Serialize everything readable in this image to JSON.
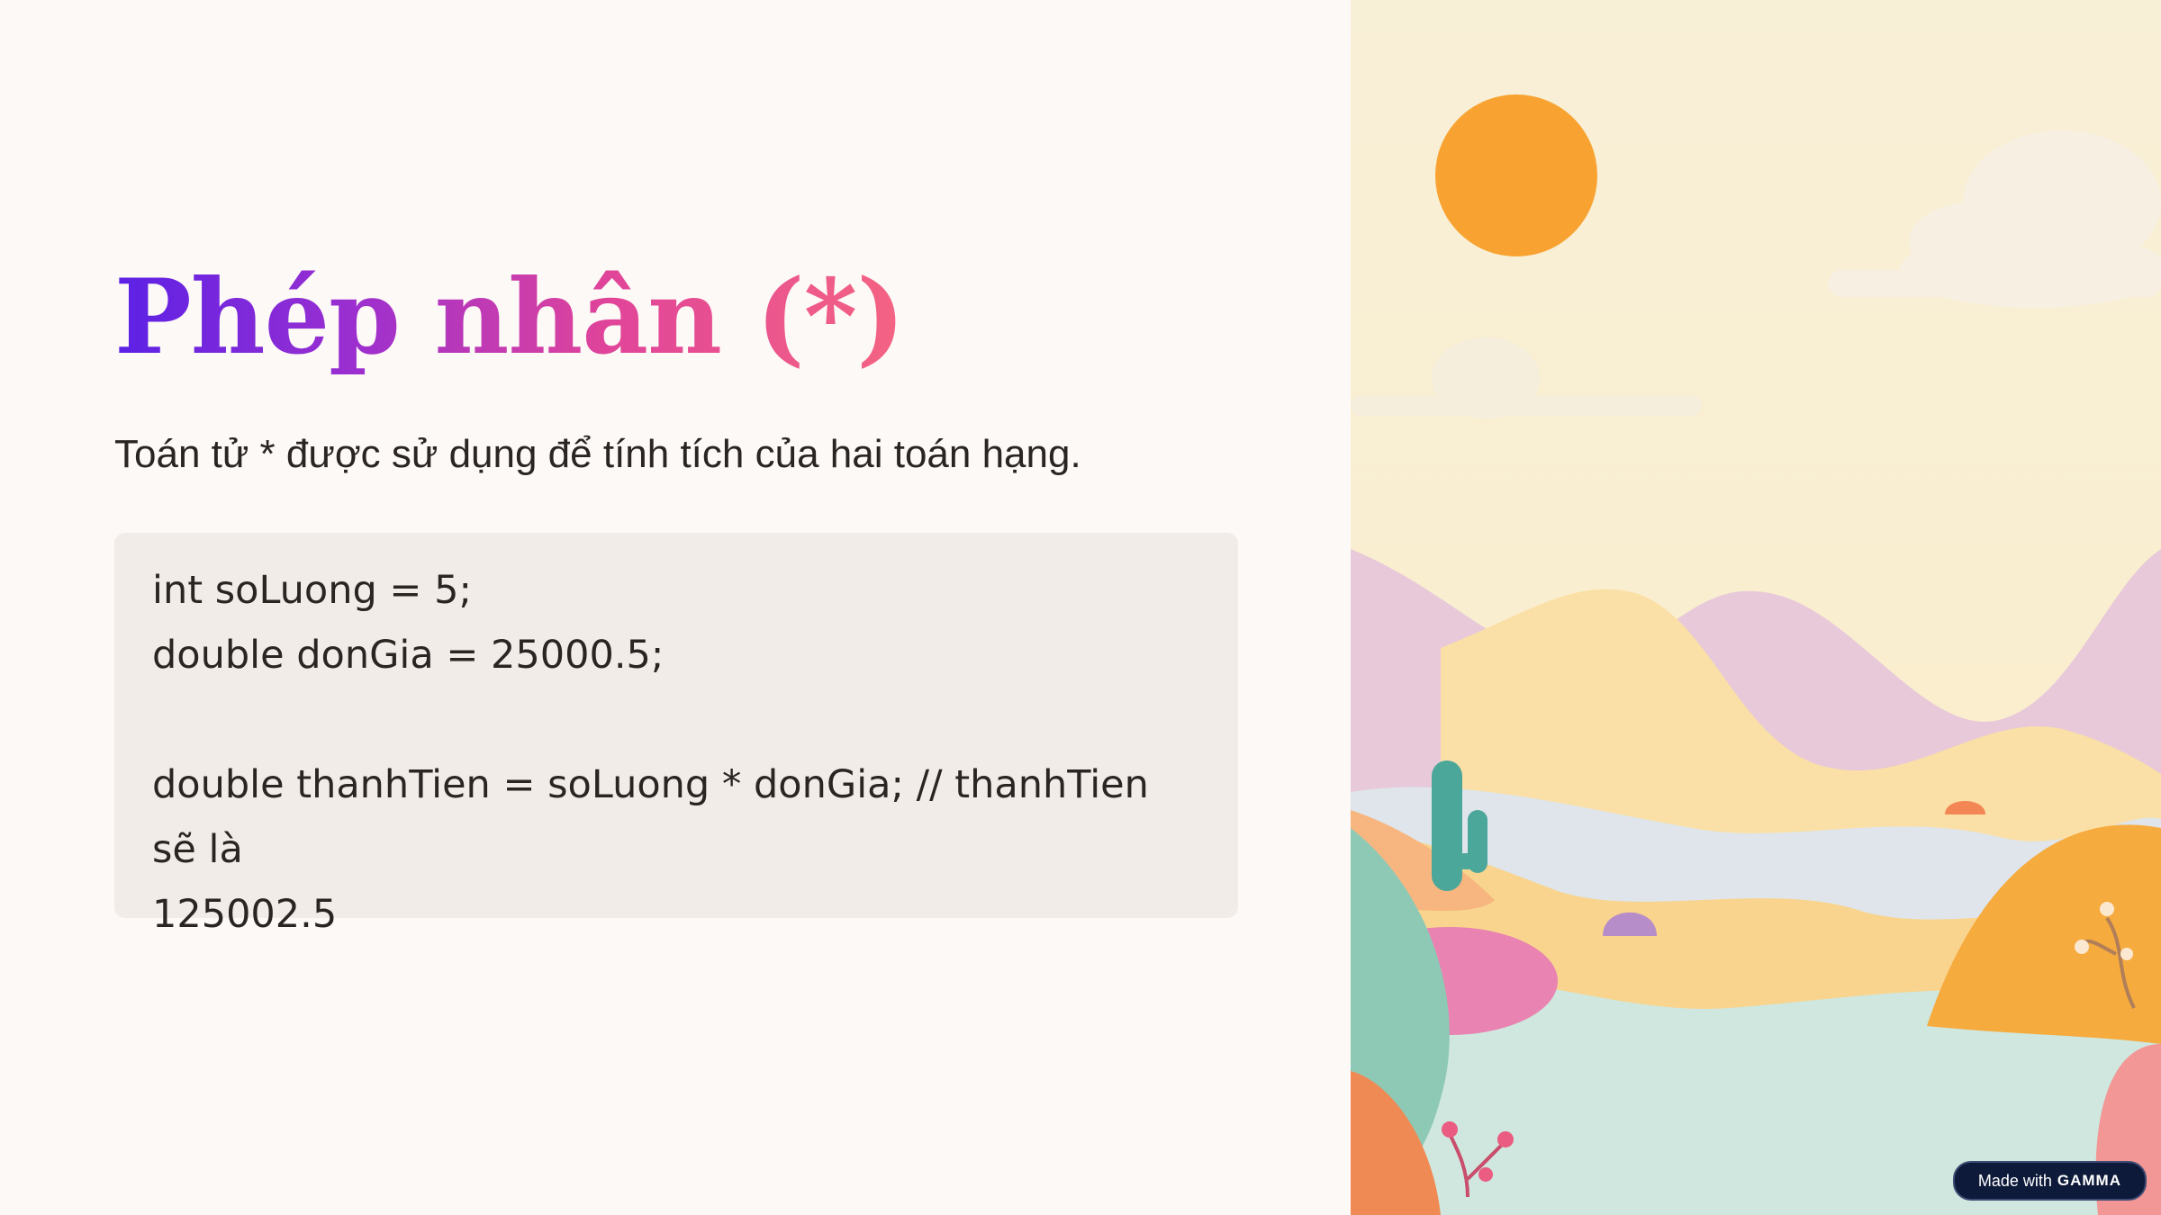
{
  "slide": {
    "title": "Phép nhân (*)",
    "description": "Toán tử * được sử dụng để tính tích của hai toán hạng.",
    "code_lines": [
      "int soLuong = 5;",
      "double donGia = 25000.5;",
      "",
      "double thanhTien = soLuong * donGia; // thanhTien sẽ là",
      "125002.5"
    ]
  },
  "badge": {
    "prefix": "Made with",
    "brand": "GAMMA"
  },
  "colors": {
    "background": "#fdf9f6",
    "code_background": "#f1ece8",
    "title_gradient": [
      "#5b21e6",
      "#e0449a",
      "#f46482"
    ],
    "sun": "#f8a331"
  },
  "illustration": {
    "icons": [
      "sun-icon",
      "cloud-icon",
      "cactus-icon",
      "flower-icon"
    ]
  }
}
